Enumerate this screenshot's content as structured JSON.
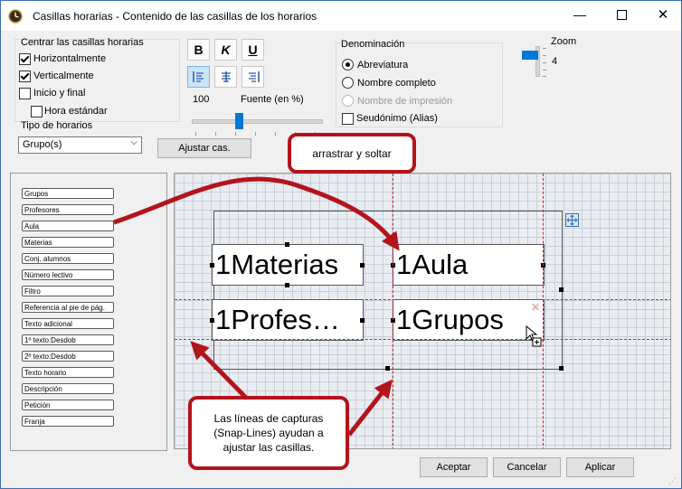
{
  "window": {
    "title": "Casillas horarias - Contenido de las casillas de los horarios"
  },
  "center": {
    "label": "Centrar las casillas horarias",
    "horizontal": "Horizontalmente",
    "vertical": "Verticalmente",
    "start_end": "Inicio y final",
    "standard_time": "Hora estándar"
  },
  "timetable_type": {
    "label": "Tipo de horarios",
    "value": "Grupo(s)"
  },
  "format": {
    "bold": "B",
    "italic": "K",
    "underline": "U",
    "font_value": "100",
    "font_label": "Fuente (en %)",
    "font_slider_percent": 35,
    "adjust_button": "Ajustar cas."
  },
  "denomination": {
    "label": "Denominación",
    "abbreviation": "Abreviatura",
    "full_name": "Nombre completo",
    "print_name": "Nombre de impresión",
    "alias": "Seudónimo (Alias)"
  },
  "zoom": {
    "label": "Zoom",
    "value": "4"
  },
  "fields": [
    "Grupos",
    "Profesores",
    "Aula",
    "Materias",
    "Conj. alumnos",
    "Número lectivo",
    "Filtro",
    "Referencia al pie de pág.",
    "Texto adicional",
    "1º texto:Desdob",
    "2º texto:Desdob",
    "Texto horario",
    "Descripción",
    "Petición",
    "Franja"
  ],
  "cells": {
    "materias": "1Materias",
    "aula": "1Aula",
    "profesores": "1Profes…",
    "grupos": "1Grupos"
  },
  "callouts": {
    "drag_drop": "arrastrar y soltar",
    "snap_lines": "Las líneas de capturas (Snap-Lines) ayudan a ajustar las casillas."
  },
  "buttons": {
    "accept": "Aceptar",
    "cancel": "Cancelar",
    "apply": "Aplicar"
  },
  "colors": {
    "callout_border": "#b3141c",
    "snap_line": "#d9242c",
    "selection": "#cce4f7"
  }
}
